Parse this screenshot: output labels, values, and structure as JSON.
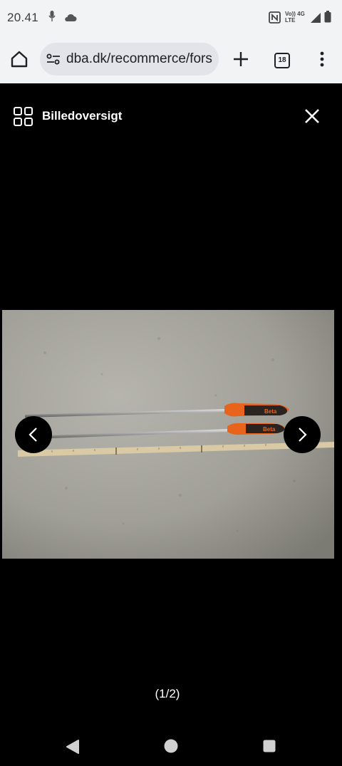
{
  "status_bar": {
    "time": "20.41",
    "network_top": "Vo)) 4G",
    "network_bottom": "LTE"
  },
  "browser": {
    "url": "dba.dk/recommerce/forsale",
    "tab_count": "18"
  },
  "viewer": {
    "overview_label": "Billedoversigt",
    "counter": "(1/2)"
  },
  "photo": {
    "handle_brand": "Beta",
    "colors": {
      "handle_orange": "#e8641c",
      "wall": "#a4a39b",
      "ruler": "#d8c9a6"
    }
  },
  "colors": {
    "chrome_bg": "#f1f3f4",
    "url_pill": "#e2e4e9",
    "viewer_bg": "#000000"
  }
}
